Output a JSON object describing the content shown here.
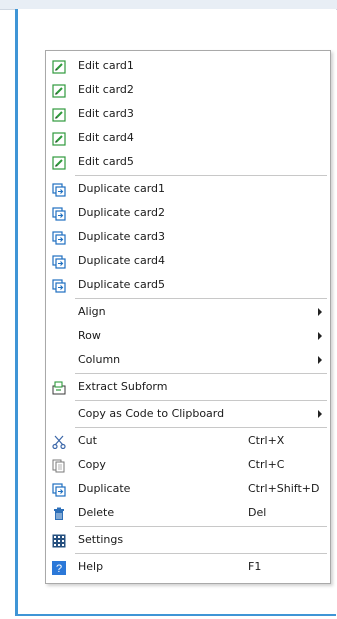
{
  "colors": {
    "accent": "#3f95d6",
    "edit_green": "#2f9a3c",
    "duplicate_blue": "#1e6fc0",
    "help_blue": "#2b78d8"
  },
  "context_menu": {
    "groups": [
      {
        "items": [
          {
            "label": "Edit card1",
            "icon": "edit-icon"
          },
          {
            "label": "Edit card2",
            "icon": "edit-icon"
          },
          {
            "label": "Edit card3",
            "icon": "edit-icon"
          },
          {
            "label": "Edit card4",
            "icon": "edit-icon"
          },
          {
            "label": "Edit card5",
            "icon": "edit-icon"
          }
        ]
      },
      {
        "items": [
          {
            "label": "Duplicate card1",
            "icon": "duplicate-icon"
          },
          {
            "label": "Duplicate card2",
            "icon": "duplicate-icon"
          },
          {
            "label": "Duplicate card3",
            "icon": "duplicate-icon"
          },
          {
            "label": "Duplicate card4",
            "icon": "duplicate-icon"
          },
          {
            "label": "Duplicate card5",
            "icon": "duplicate-icon"
          }
        ]
      },
      {
        "items": [
          {
            "label": "Align",
            "submenu": true
          },
          {
            "label": "Row",
            "submenu": true
          },
          {
            "label": "Column",
            "submenu": true
          }
        ]
      },
      {
        "items": [
          {
            "label": "Extract Subform",
            "icon": "extract-subform-icon"
          }
        ]
      },
      {
        "items": [
          {
            "label": "Copy as Code to Clipboard",
            "submenu": true
          }
        ]
      },
      {
        "items": [
          {
            "label": "Cut",
            "icon": "scissors-icon",
            "shortcut": "Ctrl+X"
          },
          {
            "label": "Copy",
            "icon": "copy-icon",
            "shortcut": "Ctrl+C"
          },
          {
            "label": "Duplicate",
            "icon": "duplicate-icon",
            "shortcut": "Ctrl+Shift+D"
          },
          {
            "label": "Delete",
            "icon": "trash-icon",
            "shortcut": "Del"
          }
        ]
      },
      {
        "items": [
          {
            "label": "Settings",
            "icon": "settings-grid-icon"
          }
        ]
      },
      {
        "items": [
          {
            "label": "Help",
            "icon": "help-icon",
            "shortcut": "F1"
          }
        ]
      }
    ]
  }
}
